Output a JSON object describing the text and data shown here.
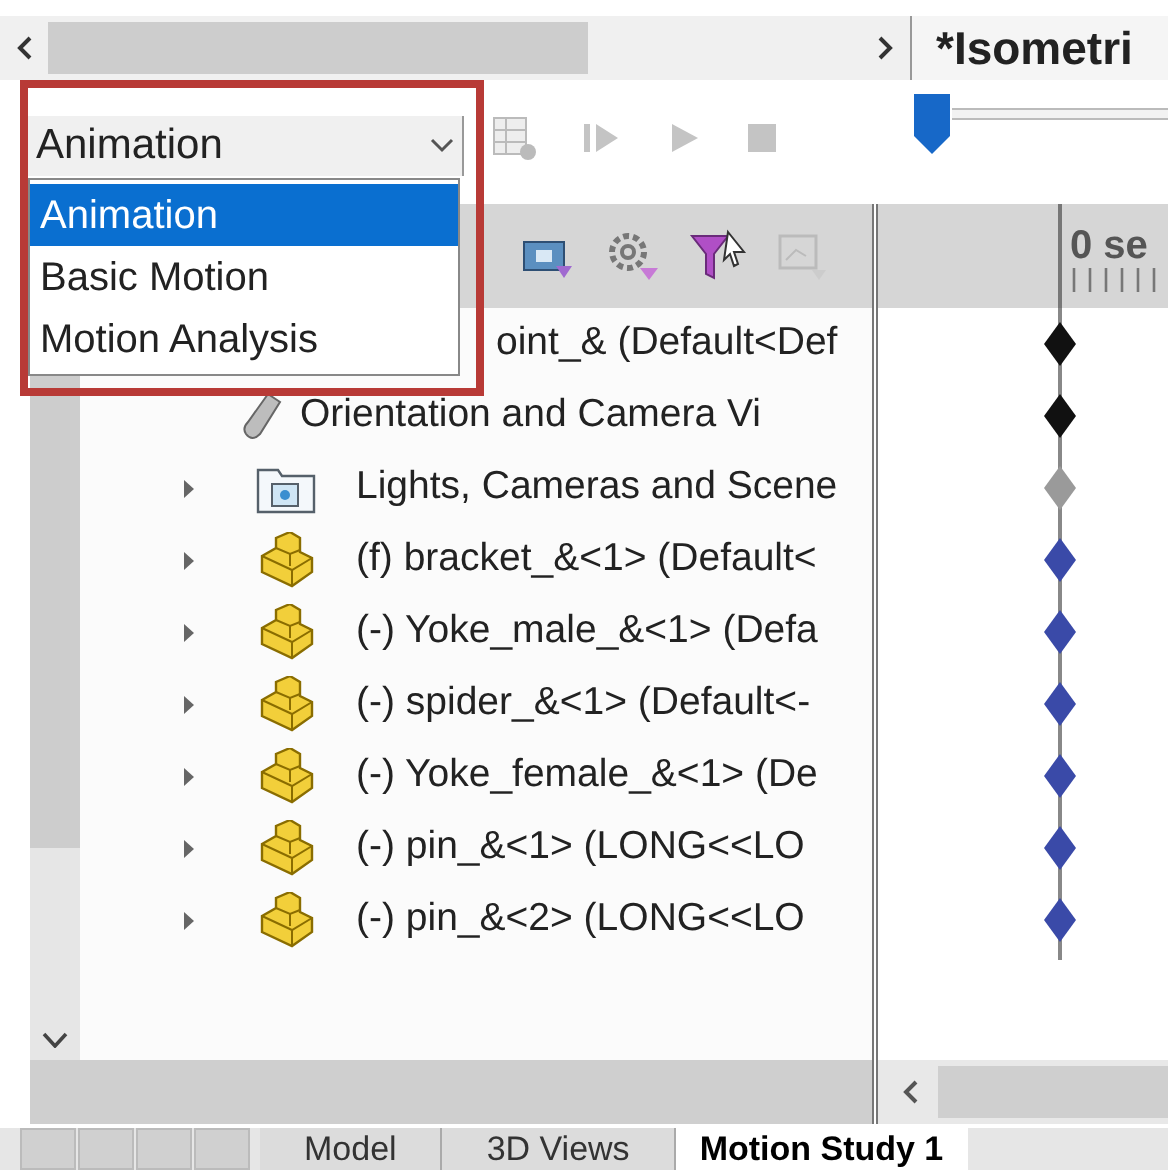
{
  "view_title": "*Isometri",
  "study_type": {
    "value": "Animation",
    "expanded": true,
    "options": [
      {
        "label": "Animation",
        "selected": true
      },
      {
        "label": "Basic Motion",
        "selected": false
      },
      {
        "label": "Motion Analysis",
        "selected": false
      }
    ]
  },
  "timeline": {
    "header": "0 se"
  },
  "tree": [
    {
      "kind": "mate",
      "label": "oint_& (Default<Def",
      "color": "#111111"
    },
    {
      "kind": "camera",
      "label": "Orientation and Camera Vi",
      "expandable": false,
      "color": "#111111"
    },
    {
      "kind": "folder",
      "label": "Lights, Cameras and Scene",
      "expandable": true,
      "color": "#9a9a9a"
    },
    {
      "kind": "part",
      "label": "(f) bracket_&<1> (Default<",
      "expandable": true,
      "color": "#3a4aa8"
    },
    {
      "kind": "part",
      "label": "(-) Yoke_male_&<1> (Defa",
      "expandable": true,
      "color": "#3a4aa8"
    },
    {
      "kind": "part",
      "label": "(-) spider_&<1> (Default<-",
      "expandable": true,
      "color": "#3a4aa8"
    },
    {
      "kind": "part",
      "label": "(-) Yoke_female_&<1> (De",
      "expandable": true,
      "color": "#3a4aa8"
    },
    {
      "kind": "part",
      "label": "(-) pin_&<1> (LONG<<LO",
      "expandable": true,
      "color": "#3a4aa8"
    },
    {
      "kind": "part",
      "label": "(-) pin_&<2> (LONG<<LO",
      "expandable": true,
      "color": "#3a4aa8"
    }
  ],
  "tabs": [
    {
      "label": "Model",
      "selected": false
    },
    {
      "label": "3D Views",
      "selected": false
    },
    {
      "label": "Motion Study 1",
      "selected": true
    }
  ]
}
